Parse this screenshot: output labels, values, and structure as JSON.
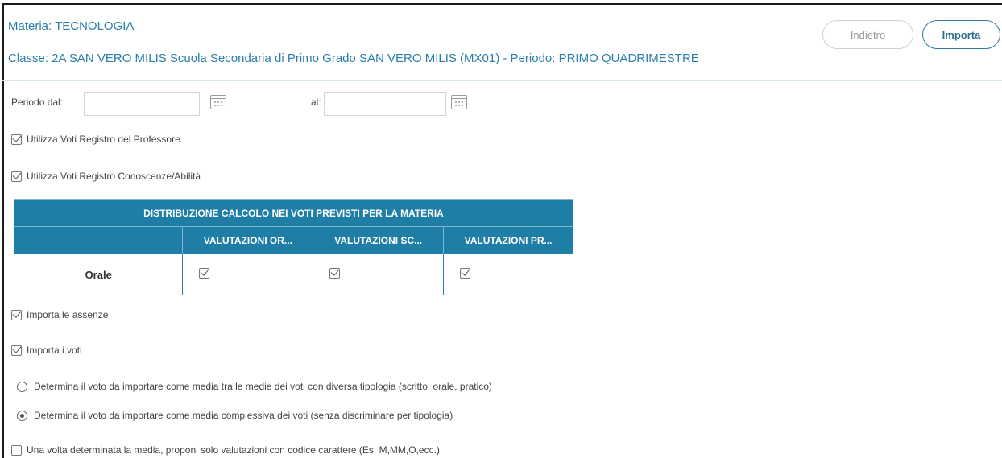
{
  "header": {
    "subject_line": "Materia: TECNOLOGIA",
    "class_line": "Classe: 2A SAN VERO MILIS Scuola Secondaria di Primo Grado SAN VERO MILIS (MX01) - Periodo: PRIMO QUADRIMESTRE"
  },
  "buttons": {
    "back_label": "Indietro",
    "import_label": "Importa"
  },
  "period": {
    "from_label": "Periodo dal:",
    "from_value": "",
    "to_label": "al:",
    "to_value": ""
  },
  "options": {
    "use_teacher_register": {
      "label": "Utilizza Voti Registro del Professore",
      "checked": true
    },
    "use_knowledge_register": {
      "label": "Utilizza Voti Registro Conoscenze/Abilità",
      "checked": true
    },
    "import_absences": {
      "label": "Importa le assenze",
      "checked": true
    },
    "import_grades": {
      "label": "Importa i voti",
      "checked": true
    },
    "propose_char_codes": {
      "label": "Una volta determinata la media, proponi solo valutazioni con codice carattere (Es. M,MM,O,ecc.)",
      "checked": false
    }
  },
  "distribution_table": {
    "title": "DISTRIBUZIONE CALCOLO NEI VOTI PREVISTI PER LA MATERIA",
    "columns": [
      "",
      "VALUTAZIONI OR...",
      "VALUTAZIONI SC...",
      "VALUTAZIONI PR..."
    ],
    "rows": [
      {
        "label": "Orale",
        "values": [
          true,
          true,
          true
        ]
      }
    ]
  },
  "calculation_mode": {
    "options": [
      {
        "label": "Determina il voto da importare come media tra le medie dei voti con diversa tipologia (scritto, orale, pratico)",
        "selected": false
      },
      {
        "label": "Determina il voto da importare come media complessiva dei voti (senza discriminare per tipologia)",
        "selected": true
      }
    ]
  }
}
